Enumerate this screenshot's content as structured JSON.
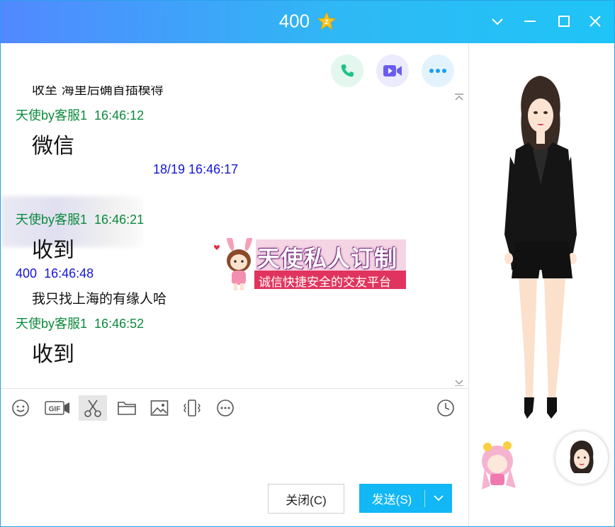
{
  "window": {
    "title": "400",
    "title_icon": "gold-star-icon",
    "accent": "#12b7f5",
    "controls": [
      "chevron-down-icon",
      "minimize-icon",
      "maximize-icon",
      "close-icon"
    ]
  },
  "top_actions": [
    {
      "name": "voice-call-icon",
      "color": "#1ec28b"
    },
    {
      "name": "video-call-icon",
      "color": "#6a5cf0"
    },
    {
      "name": "more-options-icon",
      "color": "#1a9ff2"
    }
  ],
  "chat": {
    "partial_top_text": "收至 海里后确首插模得",
    "messages": [
      {
        "sender": "天使by客服1",
        "time": "16:46:12",
        "text": "微信",
        "side": "agent"
      },
      {
        "sender": "",
        "time": "18/19  16:46:17",
        "text": "",
        "side": "user",
        "blurred": true
      },
      {
        "sender": "天使by客服1",
        "time": "16:46:21",
        "text": "收到",
        "side": "agent"
      },
      {
        "sender": "400",
        "time": "16:46:48",
        "text": "我只找上海的有缘人哈",
        "side": "user"
      },
      {
        "sender": "天使by客服1",
        "time": "16:46:52",
        "text": "收到",
        "side": "agent"
      }
    ],
    "banner": {
      "title": "天使私人订制",
      "subtitle": "诚信快捷安全的交友平台"
    }
  },
  "toolbar": {
    "items": [
      "emoji-icon",
      "gif-icon",
      "scissors-icon",
      "folder-icon",
      "image-icon",
      "shake-icon",
      "more-icon",
      "clock-icon"
    ]
  },
  "buttons": {
    "close_label": "关闭(C)",
    "send_label": "发送(S)"
  }
}
